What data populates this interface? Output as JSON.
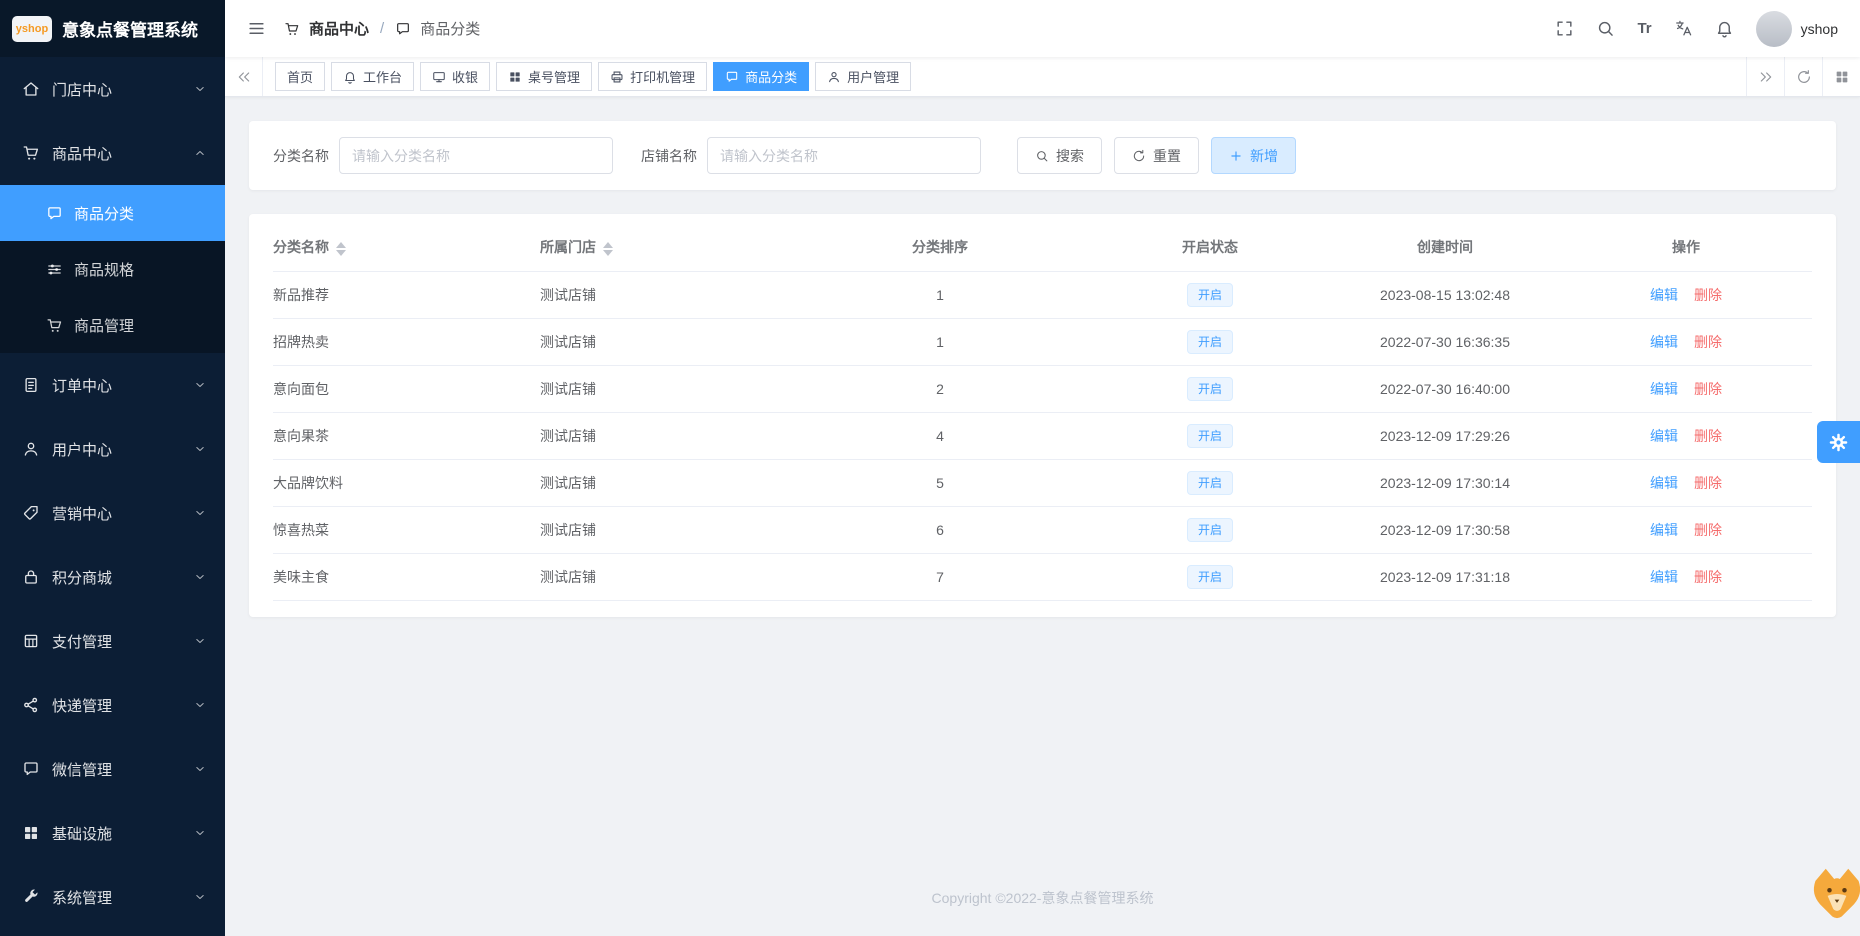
{
  "app": {
    "logo_text": "yshop",
    "title": "意象点餐管理系统",
    "username": "yshop",
    "copyright": "Copyright ©2022-意象点餐管理系统"
  },
  "colors": {
    "primary": "#409eff",
    "sidebar_bg": "#0c1e35",
    "danger": "#f56c6c",
    "status_tag_bg": "#ecf5ff",
    "status_tag_text": "#409eff"
  },
  "header": {
    "font_size_icon_label": "Tr"
  },
  "breadcrumb": {
    "level1": "商品中心",
    "separator": "/",
    "level2": "商品分类"
  },
  "sidebar": {
    "items": [
      {
        "label": "门店中心"
      },
      {
        "label": "商品中心"
      },
      {
        "label": "订单中心"
      },
      {
        "label": "用户中心"
      },
      {
        "label": "营销中心"
      },
      {
        "label": "积分商城"
      },
      {
        "label": "支付管理"
      },
      {
        "label": "快递管理"
      },
      {
        "label": "微信管理"
      },
      {
        "label": "基础设施"
      },
      {
        "label": "系统管理"
      }
    ],
    "submenu": [
      {
        "label": "商品分类",
        "active": true
      },
      {
        "label": "商品规格"
      },
      {
        "label": "商品管理"
      }
    ]
  },
  "tabs": [
    {
      "label": "首页"
    },
    {
      "label": "工作台"
    },
    {
      "label": "收银"
    },
    {
      "label": "桌号管理"
    },
    {
      "label": "打印机管理"
    },
    {
      "label": "商品分类",
      "active": true
    },
    {
      "label": "用户管理"
    }
  ],
  "filters": {
    "category_label": "分类名称",
    "category_placeholder": "请输入分类名称",
    "shop_label": "店铺名称",
    "shop_placeholder": "请输入分类名称",
    "search_button": "搜索",
    "reset_button": "重置",
    "add_button": "新增"
  },
  "table": {
    "headers": {
      "name": "分类名称",
      "shop": "所属门店",
      "sort": "分类排序",
      "status": "开启状态",
      "created": "创建时间",
      "actions": "操作"
    },
    "edit_label": "编辑",
    "delete_label": "删除",
    "rows": [
      {
        "name": "新品推荐",
        "shop": "测试店铺",
        "sort": "1",
        "status": "开启",
        "created": "2023-08-15 13:02:48"
      },
      {
        "name": "招牌热卖",
        "shop": "测试店铺",
        "sort": "1",
        "status": "开启",
        "created": "2022-07-30 16:36:35"
      },
      {
        "name": "意向面包",
        "shop": "测试店铺",
        "sort": "2",
        "status": "开启",
        "created": "2022-07-30 16:40:00"
      },
      {
        "name": "意向果茶",
        "shop": "测试店铺",
        "sort": "4",
        "status": "开启",
        "created": "2023-12-09 17:29:26"
      },
      {
        "name": "大品牌饮料",
        "shop": "测试店铺",
        "sort": "5",
        "status": "开启",
        "created": "2023-12-09 17:30:14"
      },
      {
        "name": "惊喜热菜",
        "shop": "测试店铺",
        "sort": "6",
        "status": "开启",
        "created": "2023-12-09 17:30:58"
      },
      {
        "name": "美味主食",
        "shop": "测试店铺",
        "sort": "7",
        "status": "开启",
        "created": "2023-12-09 17:31:18"
      }
    ]
  }
}
